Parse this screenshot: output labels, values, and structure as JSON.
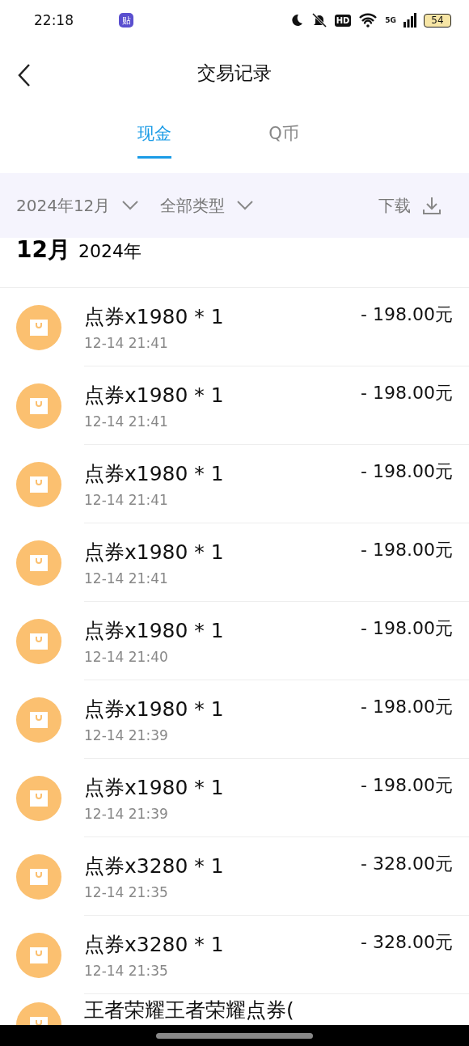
{
  "status_bar": {
    "time": "22:18",
    "app_badge": "贴",
    "hd": "HD",
    "network": "5G",
    "battery": "54"
  },
  "header": {
    "title": "交易记录"
  },
  "tabs": [
    {
      "label": "现金",
      "selected": true
    },
    {
      "label": "Q币",
      "selected": false
    }
  ],
  "filters": {
    "month": "2024年12月",
    "type": "全部类型",
    "download": "下载"
  },
  "section": {
    "month": "12月",
    "year": "2024年"
  },
  "transactions": [
    {
      "title": "点券x1980 * 1",
      "time": "12-14 21:41",
      "amount": "- 198.00元"
    },
    {
      "title": "点券x1980 * 1",
      "time": "12-14 21:41",
      "amount": "- 198.00元"
    },
    {
      "title": "点券x1980 * 1",
      "time": "12-14 21:41",
      "amount": "- 198.00元"
    },
    {
      "title": "点券x1980 * 1",
      "time": "12-14 21:41",
      "amount": "- 198.00元"
    },
    {
      "title": "点券x1980 * 1",
      "time": "12-14 21:40",
      "amount": "- 198.00元"
    },
    {
      "title": "点券x1980 * 1",
      "time": "12-14 21:39",
      "amount": "- 198.00元"
    },
    {
      "title": "点券x1980 * 1",
      "time": "12-14 21:39",
      "amount": "- 198.00元"
    },
    {
      "title": "点券x3280 * 1",
      "time": "12-14 21:35",
      "amount": "- 328.00元"
    },
    {
      "title": "点券x3280 * 1",
      "time": "12-14 21:35",
      "amount": "- 328.00元"
    },
    {
      "title": "王者荣耀王者荣耀点券("
    }
  ]
}
